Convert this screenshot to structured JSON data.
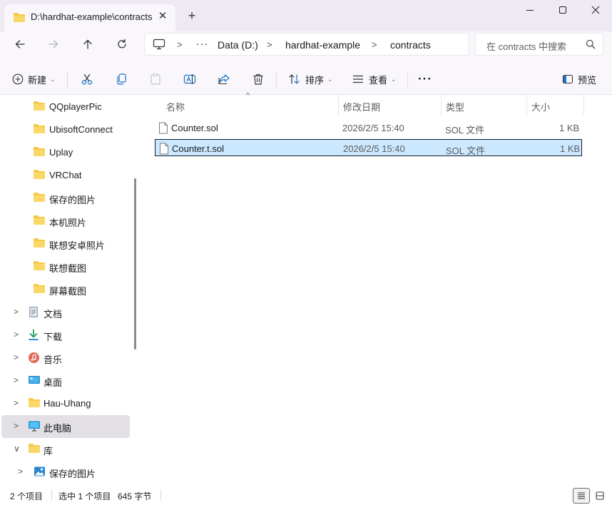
{
  "window": {
    "tab_title": "D:\\hardhat-example\\contracts",
    "close_tab": "✕",
    "new_tab": "+"
  },
  "address": {
    "more": "···",
    "crumbs": [
      "Data (D:)",
      "hardhat-example",
      "contracts"
    ],
    "separator": ">"
  },
  "search": {
    "placeholder": "在 contracts 中搜索"
  },
  "toolbar": {
    "new_label": "新建",
    "sort_label": "排序",
    "view_label": "查看",
    "more": "···",
    "preview_label": "预览"
  },
  "sidebar": {
    "items": [
      {
        "label": "QQplayerPic",
        "icon": "folder-icon"
      },
      {
        "label": "UbisoftConnect",
        "icon": "folder-icon"
      },
      {
        "label": "Uplay",
        "icon": "folder-icon"
      },
      {
        "label": "VRChat",
        "icon": "folder-icon"
      },
      {
        "label": "保存的图片",
        "icon": "folder-icon"
      },
      {
        "label": "本机照片",
        "icon": "folder-icon"
      },
      {
        "label": "联想安卓照片",
        "icon": "folder-icon"
      },
      {
        "label": "联想截图",
        "icon": "folder-icon"
      },
      {
        "label": "屏幕截图",
        "icon": "folder-icon"
      },
      {
        "label": "文档",
        "icon": "documents-icon"
      },
      {
        "label": "下载",
        "icon": "download-icon"
      },
      {
        "label": "音乐",
        "icon": "music-icon"
      },
      {
        "label": "桌面",
        "icon": "desktop-icon"
      },
      {
        "label": "Hau-Uhang",
        "icon": "folder-icon"
      },
      {
        "label": "此电脑",
        "icon": "this-pc-icon"
      },
      {
        "label": "库",
        "icon": "folder-icon"
      },
      {
        "label": "保存的图片",
        "icon": "pictures-icon"
      }
    ],
    "expand_glyph": ">",
    "collapse_glyph": "∨"
  },
  "columns": {
    "name": "名称",
    "modified": "修改日期",
    "type": "类型",
    "size": "大小",
    "sort_glyph": "^"
  },
  "files": [
    {
      "name": "Counter.sol",
      "modified": "2026/2/5 15:40",
      "type": "SOL 文件",
      "size": "1 KB"
    },
    {
      "name": "Counter.t.sol",
      "modified": "2026/2/5 15:40",
      "type": "SOL 文件",
      "size": "1 KB"
    }
  ],
  "status": {
    "count": "2 个项目",
    "selection": "选中 1 个项目",
    "size": "645 字节"
  },
  "colors": {
    "folder": "#f7c948",
    "selection": "#cce8ff",
    "titlebar": "#eee9f2"
  }
}
